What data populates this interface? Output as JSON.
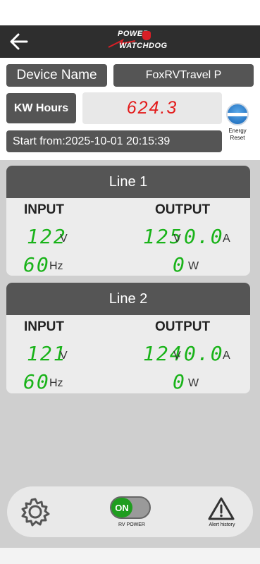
{
  "header": {
    "logo_top": "POWER",
    "logo_bottom": "WATCHDOG"
  },
  "device": {
    "name_label": "Device Name",
    "name_value": "FoxRVTravel  P"
  },
  "energy": {
    "kw_label": "KW Hours",
    "kw_value": "624.3",
    "start_from": "Start from:2025-10-01 20:15:39",
    "reset_badge": "ENERGY RESET",
    "reset_label_line1": "Energy",
    "reset_label_line2": "Reset"
  },
  "lines": [
    {
      "title": "Line 1",
      "input_label": "INPUT",
      "output_label": "OUTPUT",
      "input_voltage": "122",
      "input_voltage_unit": "V",
      "frequency": "60",
      "frequency_unit": "Hz",
      "output_voltage": "125",
      "output_voltage_unit": "V",
      "current": "0.0",
      "current_unit": "A",
      "power": "0",
      "power_unit": "W"
    },
    {
      "title": "Line 2",
      "input_label": "INPUT",
      "output_label": "OUTPUT",
      "input_voltage": "121",
      "input_voltage_unit": "V",
      "frequency": "60",
      "frequency_unit": "Hz",
      "output_voltage": "124",
      "output_voltage_unit": "V",
      "current": "0.0",
      "current_unit": "A",
      "power": "0",
      "power_unit": "W"
    }
  ],
  "bottom": {
    "toggle_state": "ON",
    "toggle_label": "RV POWER",
    "alert_label": "Alert history",
    "toggle_color": "#1f9d1f"
  },
  "colors": {
    "accent_green": "#19b319",
    "kw_red": "#e31b1b",
    "panel_dark": "#555555"
  }
}
